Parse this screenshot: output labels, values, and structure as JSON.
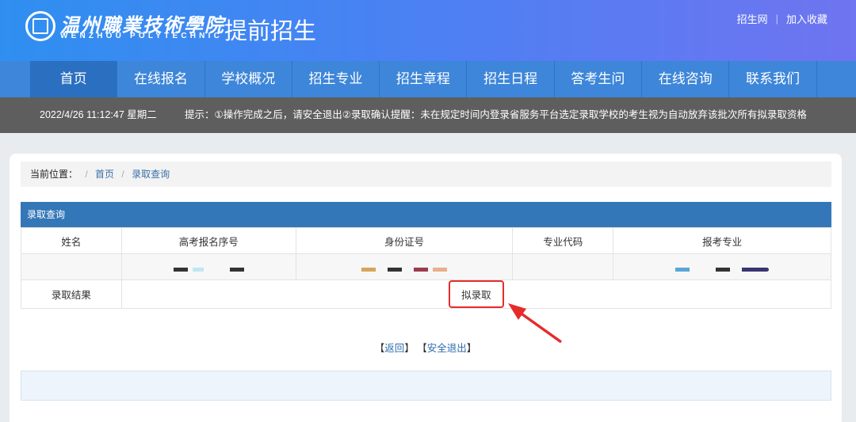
{
  "header": {
    "logo_cn": "温州職業技術學院",
    "logo_en": "WENZHOU POLYTECHNIC",
    "title": "提前招生",
    "links": [
      "招生网",
      "加入收藏"
    ],
    "link_separator": "|"
  },
  "nav": {
    "items": [
      "首页",
      "在线报名",
      "学校概况",
      "招生专业",
      "招生章程",
      "招生日程",
      "答考生问",
      "在线咨询",
      "联系我们"
    ],
    "active_index": 0
  },
  "notice": {
    "datetime": "2022/4/26 11:12:47 星期二",
    "tip": "提示：①操作完成之后，请安全退出②录取确认提醒：未在规定时间内登录省服务平台选定录取学校的考生视为自动放弃该批次所有拟录取资格"
  },
  "breadcrumb": {
    "label": "当前位置：",
    "separator": "/",
    "items": [
      "首页",
      "录取查询"
    ]
  },
  "panel": {
    "title": "录取查询",
    "columns": [
      "姓名",
      "高考报名序号",
      "身份证号",
      "专业代码",
      "报考专业"
    ],
    "result_label": "录取结果",
    "result_value": "拟录取"
  },
  "actions": {
    "back": "返回",
    "logout": "安全退出",
    "bracket_open": "【",
    "bracket_close": "】"
  },
  "colors": {
    "header_start": "#2f8ff0",
    "header_end": "#6f74f0",
    "nav": "#3d86d9",
    "panel_head": "#3477b8",
    "highlight": "#e62b2b"
  }
}
